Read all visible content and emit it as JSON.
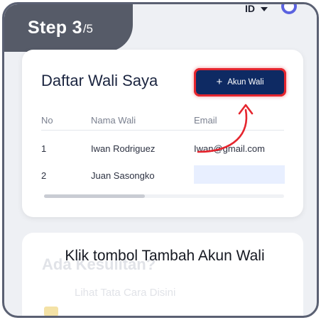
{
  "step": {
    "current": "Step 3",
    "total": "/5"
  },
  "topbar": {
    "language": "ID",
    "avatar_icon": "avatar-icon"
  },
  "card": {
    "title": "Daftar Wali Saya",
    "add_button": "Akun Wali",
    "columns": [
      "No",
      "Nama Wali",
      "Email"
    ],
    "rows": [
      {
        "no": "1",
        "name": "Iwan Rodriguez",
        "email": "Iwan@gmail.com"
      },
      {
        "no": "2",
        "name": "Juan Sasongko",
        "email": ""
      }
    ]
  },
  "help": {
    "title": "Ada Kesulitan?",
    "link": "Lihat Tata Cara Disini"
  },
  "caption": "Klik tombol Tambah Akun Wali",
  "colors": {
    "accent": "#0e2a63",
    "highlight": "#e5252e",
    "badge": "#565b68"
  }
}
